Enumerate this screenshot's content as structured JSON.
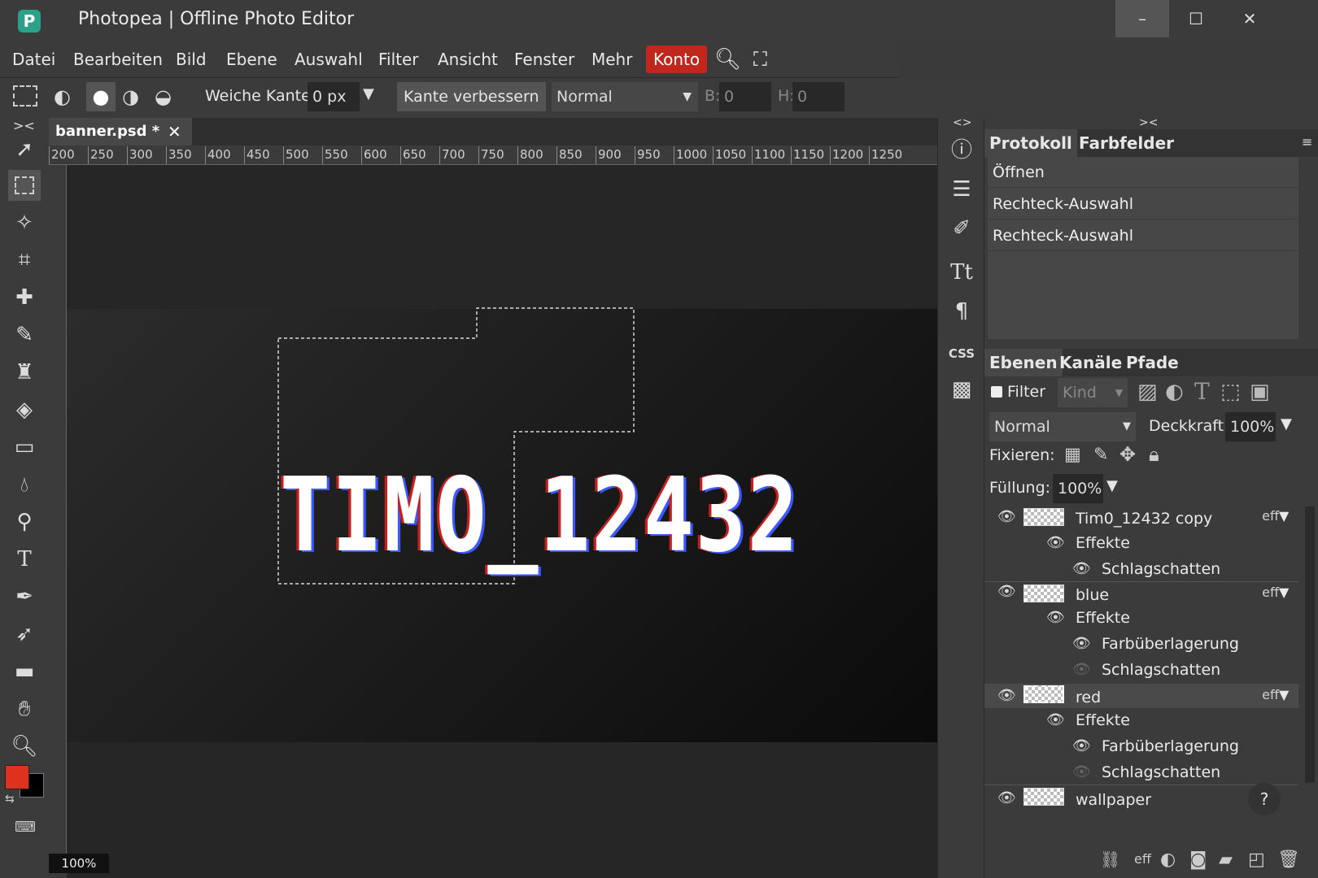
{
  "app": {
    "title": "Photopea | Offline Photo Editor",
    "logo": "P"
  },
  "window": {
    "minimize": "–",
    "maximize": "☐",
    "close": "✕"
  },
  "menu": [
    "Datei",
    "Bearbeiten",
    "Bild",
    "Ebene",
    "Auswahl",
    "Filter",
    "Ansicht",
    "Fenster",
    "Mehr"
  ],
  "konto": "Konto",
  "options": {
    "feather_label": "Weiche Kante:",
    "feather_value": "0 px",
    "refine": "Kante verbessern",
    "mode": "Normal",
    "w_label": "B:",
    "w_value": "0",
    "h_label": "H:",
    "h_value": "0"
  },
  "document": {
    "tab": "banner.psd *",
    "zoom": "100%",
    "canvas_text": "TIMO_12432"
  },
  "ruler": {
    "h": [
      "200",
      "250",
      "300",
      "350",
      "400",
      "450",
      "500",
      "550",
      "600",
      "650",
      "700",
      "750",
      "800",
      "850",
      "900",
      "950",
      "1000",
      "1050",
      "1100",
      "1150",
      "1200",
      "1250"
    ]
  },
  "history": {
    "tabs": [
      "Protokoll",
      "Farbfelder"
    ],
    "items": [
      "Öffnen",
      "Rechteck-Auswahl",
      "Rechteck-Auswahl"
    ]
  },
  "layers": {
    "tabs": [
      "Ebenen",
      "Kanäle",
      "Pfade"
    ],
    "filter_label": "Filter",
    "kind": "Kind",
    "blend": "Normal",
    "opacity_label": "Deckkraft:",
    "opacity": "100%",
    "lock_label": "Fixieren:",
    "fill_label": "Füllung:",
    "fill": "100%",
    "eff": "eff",
    "items": [
      {
        "name": "Tim0_12432 copy",
        "effects_label": "Effekte",
        "effects": [
          "Schlagschatten"
        ]
      },
      {
        "name": "blue",
        "effects_label": "Effekte",
        "effects": [
          "Farbüberlagerung",
          "Schlagschatten"
        ]
      },
      {
        "name": "red",
        "effects_label": "Effekte",
        "effects": [
          "Farbüberlagerung",
          "Schlagschatten"
        ]
      },
      {
        "name": "wallpaper"
      }
    ],
    "help": "?"
  },
  "colors": {
    "foreground": "#e0301e",
    "background": "#000000",
    "accent": "#c1271c"
  }
}
